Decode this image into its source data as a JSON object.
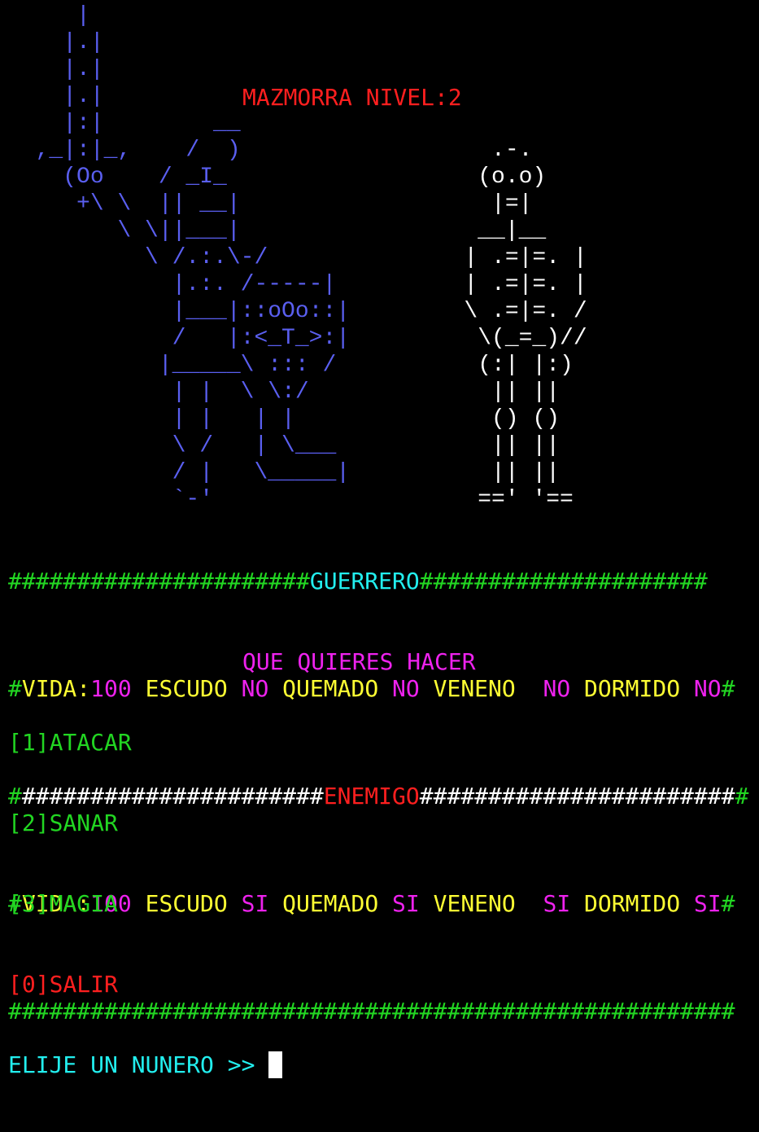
{
  "art": {
    "warrior": "     |\n    |.|\n    |.|\n    |.|\n    |:|        __\n  ,_|:|_,    /  )\n    (Oo    / _I_\n     +\\ \\  || __|\n        \\ \\||___|\n          \\ /.:.\\-/\n            |.:. /-----|\n            |___|::oOo::|\n            /   |:<_T_>:|\n           |_____\\ ::: /\n            | |  \\ \\:/\n            | |   | |\n            \\ /   | \\___\n            / |   \\_____|\n            `-'",
    "skeleton": "     .-.\n    (o.o)\n     |=|\n    __|__\n   | .=|=. |\n   | .=|=. |\n   \\ .=|=. /\n    \\(_=_)//\n    (:| |:)\n     || ||\n     () ()\n     || ||\n     || ||\n    ==' '=="
  },
  "title": "MAZMORRA NIVEL:2",
  "hud": {
    "border_left_1": "######################",
    "guerrero": "GUERRERO",
    "border_right_1": "#####################",
    "player": {
      "hash_left": "#",
      "vida_label": "VIDA:",
      "vida_value": "100",
      "escudo_label": " ESCUDO ",
      "escudo_value": "NO",
      "quemado_label": " QUEMADO ",
      "quemado_value": "NO",
      "veneno_label": " VENENO  ",
      "veneno_value": "NO",
      "dormido_label": " DORMIDO ",
      "dormido_value": "NO",
      "hash_right": "#"
    },
    "border_left_2_green": "#",
    "border_left_2_white": "######################",
    "enemigo": "ENEMIGO",
    "border_right_2_white": "#######################",
    "border_right_2_green": "#",
    "enemy": {
      "hash_left": "#",
      "vida_label": "VIDA:",
      "vida_value": "100",
      "escudo_label": " ESCUDO ",
      "escudo_value": "SI",
      "quemado_label": " QUEMADO ",
      "quemado_value": "SI",
      "veneno_label": " VENENO  ",
      "veneno_value": "SI",
      "dormido_label": " DORMIDO ",
      "dormido_value": "SI",
      "hash_right": "#"
    },
    "border_full": "#####################################################"
  },
  "menu": {
    "prompt_title": "QUE QUIERES HACER",
    "options": [
      {
        "key": "[1]",
        "label": "ATACAR"
      },
      {
        "key": "[2]",
        "label": "SANAR"
      },
      {
        "key": "[3]",
        "label": "MAGIA"
      },
      {
        "key": "[0]",
        "label": "SALIR"
      }
    ],
    "input_prompt": "ELIJE UN NUNERO >> "
  },
  "colors": {
    "background": "#000000",
    "warrior": "#5a5ff0",
    "border": "#22d622",
    "label": "#ffff33",
    "value": "#ee22ee",
    "heading": "#22eeee",
    "danger": "#ff1f1f"
  }
}
